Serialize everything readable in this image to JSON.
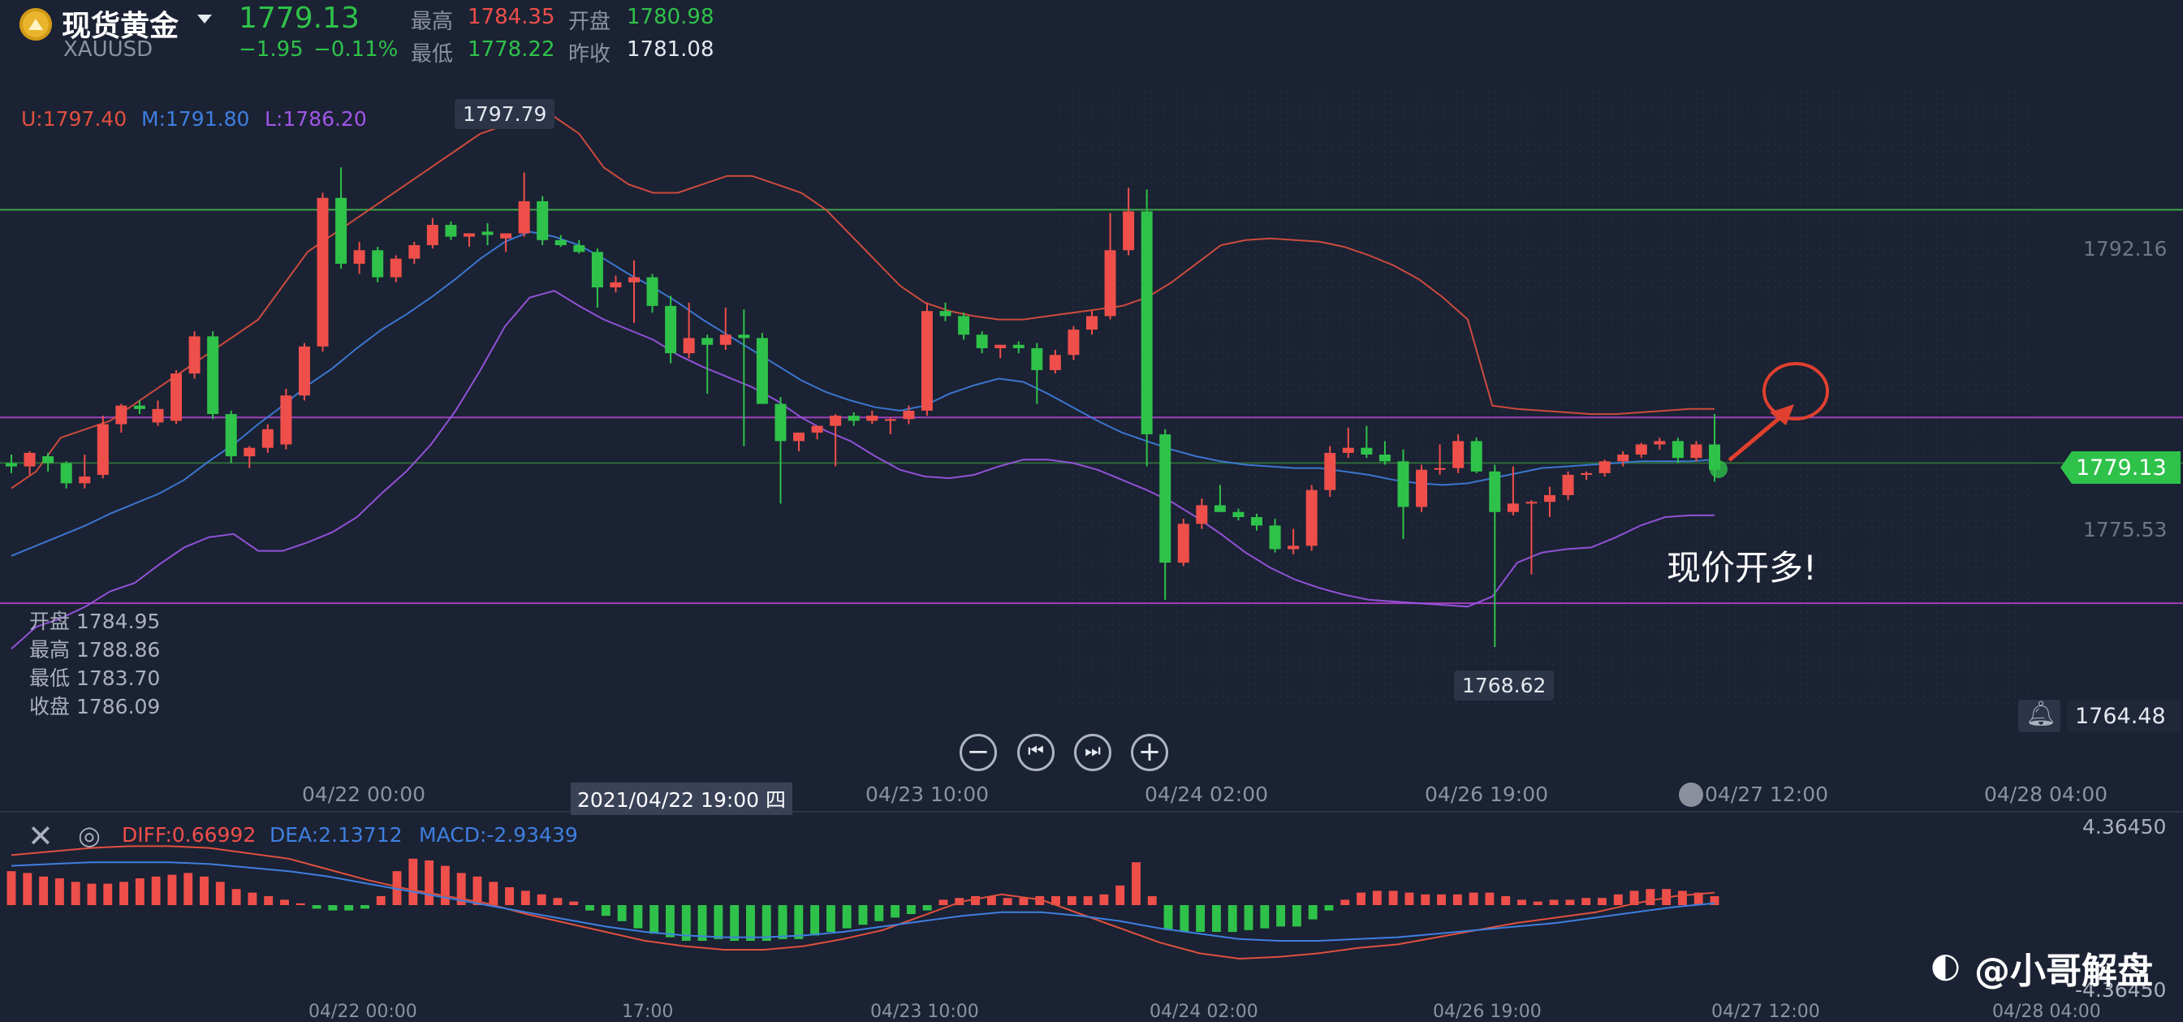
{
  "header": {
    "title": "现货黄金",
    "symbol": "XAUUSD",
    "price": "1779.13",
    "change": "−1.95",
    "change_pct": "−0.11%",
    "high_label": "最高",
    "high_value": "1784.35",
    "low_label": "最低",
    "low_value": "1778.22",
    "open_label": "开盘",
    "open_value": "1780.98",
    "prev_close_label": "昨收",
    "prev_close_value": "1781.08"
  },
  "boll": {
    "u": "U:1797.40",
    "m": "M:1791.80",
    "l": "L:1786.20"
  },
  "ohlc_panel": {
    "open": "开盘 1784.95",
    "high": "最高 1788.86",
    "low": "最低 1783.70",
    "close": "收盘 1786.09"
  },
  "annotations": {
    "max_label": "1797.79",
    "min_label": "1768.62",
    "call_text": "现价开多!",
    "current_price_tag": "1779.13",
    "alert_price": "1764.48",
    "crosshair_time": "2021/04/22 19:00 四"
  },
  "macd": {
    "diff": "DIFF:0.66992",
    "dea": "DEA:2.13712",
    "macd": "MACD:-2.93439",
    "top": "4.36450",
    "bottom": "-4.36450"
  },
  "watermark": "@小哥解盘",
  "colors": {
    "up": "#ef4f4a",
    "down": "#2fc24a",
    "upper": "#e0503f",
    "mid": "#3f7fe0",
    "lower": "#9f56e8",
    "bg": "#1b2233"
  },
  "chart_data": {
    "type": "candlestick",
    "y_axis_ticks": [
      1792.16,
      1775.53
    ],
    "x_axis_labels": [
      "04/22 00:00",
      "04/23 10:00",
      "04/24 02:00",
      "04/26 19:00",
      "04/27 12:00",
      "04/28 04:00"
    ],
    "macd_x_labels": [
      "04/22 00:00",
      "17:00",
      "04/23 10:00",
      "04/24 02:00",
      "04/26 19:00",
      "04/27 12:00",
      "04/28 04:00"
    ],
    "horizontal_lines": [
      {
        "value": 1794.5,
        "color": "#3fa64a"
      },
      {
        "value": 1782.2,
        "color": "#a23fbd"
      },
      {
        "value": 1779.5,
        "color": "#2f6a3a"
      },
      {
        "value": 1771.2,
        "color": "#a23fbd"
      }
    ],
    "candles": [
      {
        "o": 1779.5,
        "h": 1780.0,
        "l": 1778.9,
        "c": 1779.3
      },
      {
        "o": 1779.3,
        "h": 1780.2,
        "l": 1778.8,
        "c": 1780.1
      },
      {
        "o": 1779.9,
        "h": 1780.1,
        "l": 1779.0,
        "c": 1779.5
      },
      {
        "o": 1779.5,
        "h": 1779.6,
        "l": 1778.0,
        "c": 1778.3
      },
      {
        "o": 1778.3,
        "h": 1780.0,
        "l": 1778.0,
        "c": 1778.7
      },
      {
        "o": 1778.8,
        "h": 1782.3,
        "l": 1778.6,
        "c": 1781.8
      },
      {
        "o": 1781.8,
        "h": 1783.0,
        "l": 1781.3,
        "c": 1782.9
      },
      {
        "o": 1782.9,
        "h": 1783.2,
        "l": 1782.4,
        "c": 1782.7
      },
      {
        "o": 1781.9,
        "h": 1783.2,
        "l": 1781.7,
        "c": 1782.7
      },
      {
        "o": 1782.0,
        "h": 1785.0,
        "l": 1781.8,
        "c": 1784.8
      },
      {
        "o": 1784.8,
        "h": 1787.3,
        "l": 1784.5,
        "c": 1787.0
      },
      {
        "o": 1787.0,
        "h": 1787.3,
        "l": 1782.1,
        "c": 1782.4
      },
      {
        "o": 1782.4,
        "h": 1782.6,
        "l": 1779.5,
        "c": 1779.9
      },
      {
        "o": 1779.9,
        "h": 1780.5,
        "l": 1779.2,
        "c": 1780.4
      },
      {
        "o": 1780.4,
        "h": 1781.8,
        "l": 1780.1,
        "c": 1781.5
      },
      {
        "o": 1780.6,
        "h": 1783.9,
        "l": 1780.3,
        "c": 1783.5
      },
      {
        "o": 1783.5,
        "h": 1786.6,
        "l": 1783.2,
        "c": 1786.4
      },
      {
        "o": 1786.4,
        "h": 1795.5,
        "l": 1786.1,
        "c": 1795.2
      },
      {
        "o": 1795.2,
        "h": 1797.0,
        "l": 1791.0,
        "c": 1791.3
      },
      {
        "o": 1791.3,
        "h": 1792.6,
        "l": 1790.7,
        "c": 1792.1
      },
      {
        "o": 1792.1,
        "h": 1792.3,
        "l": 1790.2,
        "c": 1790.5
      },
      {
        "o": 1790.5,
        "h": 1791.8,
        "l": 1790.2,
        "c": 1791.6
      },
      {
        "o": 1791.6,
        "h": 1792.6,
        "l": 1791.3,
        "c": 1792.4
      },
      {
        "o": 1792.4,
        "h": 1794.0,
        "l": 1792.2,
        "c": 1793.6
      },
      {
        "o": 1793.6,
        "h": 1793.8,
        "l": 1792.7,
        "c": 1792.9
      },
      {
        "o": 1792.9,
        "h": 1793.1,
        "l": 1792.3,
        "c": 1793.1
      },
      {
        "o": 1793.2,
        "h": 1793.7,
        "l": 1792.4,
        "c": 1793.0
      },
      {
        "o": 1792.8,
        "h": 1793.1,
        "l": 1792.0,
        "c": 1793.1
      },
      {
        "o": 1793.1,
        "h": 1796.7,
        "l": 1792.9,
        "c": 1795.0
      },
      {
        "o": 1795.0,
        "h": 1795.3,
        "l": 1792.4,
        "c": 1792.7
      },
      {
        "o": 1792.7,
        "h": 1793.0,
        "l": 1792.3,
        "c": 1792.4
      },
      {
        "o": 1792.4,
        "h": 1792.7,
        "l": 1791.9,
        "c": 1792.0
      },
      {
        "o": 1792.0,
        "h": 1792.2,
        "l": 1788.7,
        "c": 1789.9
      },
      {
        "o": 1789.9,
        "h": 1790.6,
        "l": 1789.6,
        "c": 1790.2
      },
      {
        "o": 1790.2,
        "h": 1791.5,
        "l": 1787.8,
        "c": 1790.5
      },
      {
        "o": 1790.5,
        "h": 1790.7,
        "l": 1788.4,
        "c": 1788.8
      },
      {
        "o": 1788.8,
        "h": 1789.4,
        "l": 1785.4,
        "c": 1786.0
      },
      {
        "o": 1786.0,
        "h": 1789.0,
        "l": 1785.7,
        "c": 1786.9
      },
      {
        "o": 1786.9,
        "h": 1787.1,
        "l": 1783.6,
        "c": 1786.5
      },
      {
        "o": 1786.5,
        "h": 1788.7,
        "l": 1786.2,
        "c": 1787.1
      },
      {
        "o": 1787.1,
        "h": 1788.6,
        "l": 1780.5,
        "c": 1786.9
      },
      {
        "o": 1786.9,
        "h": 1787.2,
        "l": 1786.1,
        "c": 1783.0
      },
      {
        "o": 1783.0,
        "h": 1783.4,
        "l": 1777.1,
        "c": 1780.8
      },
      {
        "o": 1780.8,
        "h": 1781.1,
        "l": 1780.2,
        "c": 1781.3
      },
      {
        "o": 1781.3,
        "h": 1781.6,
        "l": 1780.9,
        "c": 1781.7
      },
      {
        "o": 1781.7,
        "h": 1782.4,
        "l": 1779.3,
        "c": 1782.3
      },
      {
        "o": 1782.3,
        "h": 1782.5,
        "l": 1781.7,
        "c": 1782.0
      },
      {
        "o": 1782.0,
        "h": 1782.6,
        "l": 1781.8,
        "c": 1782.3
      },
      {
        "o": 1782.0,
        "h": 1782.2,
        "l": 1781.2,
        "c": 1782.1
      },
      {
        "o": 1782.1,
        "h": 1782.9,
        "l": 1781.8,
        "c": 1782.6
      },
      {
        "o": 1782.6,
        "h": 1789.0,
        "l": 1782.3,
        "c": 1788.5
      },
      {
        "o": 1788.5,
        "h": 1789.0,
        "l": 1787.9,
        "c": 1788.2
      },
      {
        "o": 1788.2,
        "h": 1788.4,
        "l": 1786.8,
        "c": 1787.1
      },
      {
        "o": 1787.1,
        "h": 1787.3,
        "l": 1786.0,
        "c": 1786.3
      },
      {
        "o": 1786.3,
        "h": 1786.5,
        "l": 1785.7,
        "c": 1786.5
      },
      {
        "o": 1786.5,
        "h": 1786.7,
        "l": 1786.0,
        "c": 1786.3
      },
      {
        "o": 1786.3,
        "h": 1786.6,
        "l": 1783.0,
        "c": 1785.0
      },
      {
        "o": 1785.0,
        "h": 1786.2,
        "l": 1784.8,
        "c": 1785.9
      },
      {
        "o": 1785.9,
        "h": 1787.6,
        "l": 1785.6,
        "c": 1787.4
      },
      {
        "o": 1787.4,
        "h": 1788.5,
        "l": 1787.1,
        "c": 1788.2
      },
      {
        "o": 1788.2,
        "h": 1794.3,
        "l": 1788.0,
        "c": 1792.1
      },
      {
        "o": 1792.1,
        "h": 1795.8,
        "l": 1791.8,
        "c": 1794.4
      },
      {
        "o": 1794.4,
        "h": 1795.7,
        "l": 1779.3,
        "c": 1781.2
      },
      {
        "o": 1781.2,
        "h": 1781.5,
        "l": 1771.4,
        "c": 1773.6
      },
      {
        "o": 1773.6,
        "h": 1776.2,
        "l": 1773.4,
        "c": 1775.9
      },
      {
        "o": 1775.9,
        "h": 1777.4,
        "l": 1775.6,
        "c": 1777.0
      },
      {
        "o": 1777.0,
        "h": 1778.2,
        "l": 1776.7,
        "c": 1776.6
      },
      {
        "o": 1776.6,
        "h": 1776.8,
        "l": 1776.1,
        "c": 1776.3
      },
      {
        "o": 1776.3,
        "h": 1776.5,
        "l": 1775.5,
        "c": 1775.8
      },
      {
        "o": 1775.8,
        "h": 1776.2,
        "l": 1774.2,
        "c": 1774.4
      },
      {
        "o": 1774.4,
        "h": 1775.6,
        "l": 1774.1,
        "c": 1774.6
      },
      {
        "o": 1774.6,
        "h": 1778.2,
        "l": 1774.3,
        "c": 1777.9
      },
      {
        "o": 1777.9,
        "h": 1780.5,
        "l": 1777.5,
        "c": 1780.1
      },
      {
        "o": 1780.1,
        "h": 1781.6,
        "l": 1779.8,
        "c": 1780.4
      },
      {
        "o": 1780.4,
        "h": 1781.7,
        "l": 1779.8,
        "c": 1780.0
      },
      {
        "o": 1780.0,
        "h": 1780.8,
        "l": 1779.4,
        "c": 1779.6
      },
      {
        "o": 1779.6,
        "h": 1780.3,
        "l": 1775.0,
        "c": 1776.9
      },
      {
        "o": 1776.9,
        "h": 1779.4,
        "l": 1776.6,
        "c": 1779.1
      },
      {
        "o": 1779.1,
        "h": 1780.6,
        "l": 1778.8,
        "c": 1779.2
      },
      {
        "o": 1779.2,
        "h": 1781.2,
        "l": 1778.9,
        "c": 1780.8
      },
      {
        "o": 1780.8,
        "h": 1781.0,
        "l": 1778.9,
        "c": 1779.0
      },
      {
        "o": 1779.0,
        "h": 1779.4,
        "l": 1768.6,
        "c": 1776.6
      },
      {
        "o": 1776.6,
        "h": 1779.3,
        "l": 1776.4,
        "c": 1777.1
      },
      {
        "o": 1777.1,
        "h": 1777.3,
        "l": 1772.9,
        "c": 1777.2
      },
      {
        "o": 1777.2,
        "h": 1778.1,
        "l": 1776.3,
        "c": 1777.6
      },
      {
        "o": 1777.6,
        "h": 1779.0,
        "l": 1777.3,
        "c": 1778.8
      },
      {
        "o": 1778.8,
        "h": 1779.0,
        "l": 1778.5,
        "c": 1778.9
      },
      {
        "o": 1778.9,
        "h": 1779.7,
        "l": 1778.7,
        "c": 1779.6
      },
      {
        "o": 1779.6,
        "h": 1780.2,
        "l": 1779.3,
        "c": 1780.0
      },
      {
        "o": 1780.0,
        "h": 1780.7,
        "l": 1779.8,
        "c": 1780.6
      },
      {
        "o": 1780.6,
        "h": 1781.0,
        "l": 1780.3,
        "c": 1780.8
      },
      {
        "o": 1780.8,
        "h": 1781.0,
        "l": 1779.5,
        "c": 1779.8
      },
      {
        "o": 1779.8,
        "h": 1780.8,
        "l": 1779.6,
        "c": 1780.6
      },
      {
        "o": 1780.6,
        "h": 1782.4,
        "l": 1778.4,
        "c": 1779.1
      }
    ],
    "upper_band": [
      1778,
      1779,
      1781,
      1781.5,
      1782,
      1783,
      1784,
      1785,
      1786,
      1787,
      1788,
      1790,
      1792,
      1793,
      1794,
      1795,
      1796,
      1797,
      1798,
      1799,
      1799.5,
      1800,
      1800,
      1799,
      1797,
      1796,
      1795.5,
      1795.5,
      1796,
      1796.5,
      1796.5,
      1796,
      1795.5,
      1794.5,
      1793,
      1791.5,
      1790,
      1789,
      1788.5,
      1788.2,
      1788,
      1788,
      1788.2,
      1788.4,
      1788.6,
      1788.8,
      1789.3,
      1790.2,
      1791.3,
      1792.4,
      1792.7,
      1792.8,
      1792.7,
      1792.6,
      1792.3,
      1791.8,
      1791.2,
      1790.4,
      1789.3,
      1788.0,
      1782.9,
      1782.7,
      1782.6,
      1782.5,
      1782.4,
      1782.4,
      1782.5,
      1782.6,
      1782.7,
      1782.7
    ],
    "mid_band": [
      1774,
      1774.6,
      1775.2,
      1775.8,
      1776.5,
      1777.1,
      1777.7,
      1778.5,
      1779.6,
      1780.6,
      1781.8,
      1782.9,
      1784.1,
      1785.1,
      1786.3,
      1787.4,
      1788.3,
      1789.3,
      1790.4,
      1791.6,
      1792.6,
      1793.2,
      1792.9,
      1792.4,
      1791.6,
      1790.7,
      1789.9,
      1789.0,
      1788.0,
      1787.1,
      1786.2,
      1785.3,
      1784.4,
      1783.7,
      1783.2,
      1782.8,
      1782.6,
      1782.9,
      1783.6,
      1784.1,
      1784.5,
      1784.3,
      1783.6,
      1782.8,
      1782.0,
      1781.3,
      1780.8,
      1780.3,
      1779.9,
      1779.6,
      1779.4,
      1779.3,
      1779.2,
      1779.2,
      1779.0,
      1778.8,
      1778.5,
      1778.3,
      1778.2,
      1778.3,
      1778.6,
      1778.9,
      1779.2,
      1779.3,
      1779.4,
      1779.5,
      1779.6,
      1779.6,
      1779.6,
      1779.7
    ],
    "lower_band": [
      1768.5,
      1769.8,
      1770.3,
      1771,
      1771.9,
      1772.4,
      1773.5,
      1774.5,
      1775.1,
      1775.3,
      1774.3,
      1774.3,
      1774.8,
      1775.4,
      1776.3,
      1777.7,
      1779.0,
      1780.6,
      1782.6,
      1785.0,
      1787.6,
      1789.3,
      1789.7,
      1788.8,
      1788.0,
      1787.4,
      1786.8,
      1785.9,
      1785.2,
      1784.6,
      1784.0,
      1783.2,
      1782.2,
      1781.4,
      1780.8,
      1779.9,
      1779.1,
      1778.7,
      1778.6,
      1778.8,
      1779.3,
      1779.7,
      1779.7,
      1779.5,
      1779.1,
      1778.5,
      1777.9,
      1777.2,
      1776.3,
      1775.3,
      1774.2,
      1773.3,
      1772.6,
      1772.1,
      1771.7,
      1771.4,
      1771.3,
      1771.2,
      1771.1,
      1771.0,
      1771.6,
      1773.6,
      1774.2,
      1774.4,
      1774.5,
      1775.1,
      1775.8,
      1776.3,
      1776.4,
      1776.4
    ],
    "macd_hist": [
      1.9,
      1.8,
      1.6,
      1.5,
      1.3,
      1.2,
      1.2,
      1.3,
      1.5,
      1.6,
      1.7,
      1.8,
      1.6,
      1.3,
      0.9,
      0.7,
      0.5,
      0.3,
      0.1,
      -0.2,
      -0.3,
      -0.3,
      -0.2,
      0.5,
      1.9,
      2.6,
      2.5,
      2.2,
      1.8,
      1.6,
      1.3,
      1.0,
      0.8,
      0.6,
      0.4,
      0.2,
      -0.3,
      -0.6,
      -0.9,
      -1.3,
      -1.6,
      -1.8,
      -2.0,
      -2.0,
      -1.9,
      -2.0,
      -2.0,
      -2.0,
      -1.9,
      -1.9,
      -1.7,
      -1.5,
      -1.3,
      -1.1,
      -0.9,
      -0.7,
      -0.5,
      -0.3,
      0.3,
      0.4,
      0.5,
      0.5,
      0.4,
      0.4,
      0.5,
      0.5,
      0.5,
      0.5,
      0.6,
      1.1,
      2.4,
      0.5,
      -1.4,
      -1.5,
      -1.5,
      -1.5,
      -1.5,
      -1.4,
      -1.3,
      -1.2,
      -1.2,
      -0.8,
      -0.3,
      0.3,
      0.7,
      0.8,
      0.8,
      0.7,
      0.6,
      0.6,
      0.6,
      0.7,
      0.7,
      0.5,
      0.3,
      0.2,
      0.3,
      0.3,
      0.4,
      0.4,
      0.6,
      0.8,
      0.9,
      0.9,
      0.8,
      0.7,
      0.5
    ],
    "macd_diff": [
      2.8,
      3.0,
      3.2,
      3.3,
      3.3,
      3.2,
      2.9,
      2.6,
      2.0,
      1.4,
      0.9,
      0.5,
      0.1,
      -0.5,
      -1.0,
      -1.5,
      -2.0,
      -2.3,
      -2.5,
      -2.5,
      -2.3,
      -1.9,
      -1.4,
      -0.6,
      0.2,
      0.6,
      0.3,
      -0.5,
      -1.3,
      -2.1,
      -2.7,
      -3.0,
      -2.9,
      -2.7,
      -2.4,
      -2.2,
      -1.8,
      -1.4,
      -1.0,
      -0.7,
      -0.4,
      0.1,
      0.5,
      0.7
    ],
    "macd_dea": [
      2.2,
      2.3,
      2.4,
      2.4,
      2.4,
      2.3,
      2.1,
      1.9,
      1.6,
      1.2,
      0.8,
      0.4,
      0.0,
      -0.4,
      -0.8,
      -1.2,
      -1.5,
      -1.7,
      -1.8,
      -1.8,
      -1.7,
      -1.5,
      -1.2,
      -0.9,
      -0.6,
      -0.4,
      -0.4,
      -0.6,
      -0.9,
      -1.3,
      -1.6,
      -1.9,
      -2.0,
      -2.0,
      -1.9,
      -1.8,
      -1.6,
      -1.4,
      -1.2,
      -1.0,
      -0.7,
      -0.4,
      -0.1,
      0.1
    ]
  }
}
